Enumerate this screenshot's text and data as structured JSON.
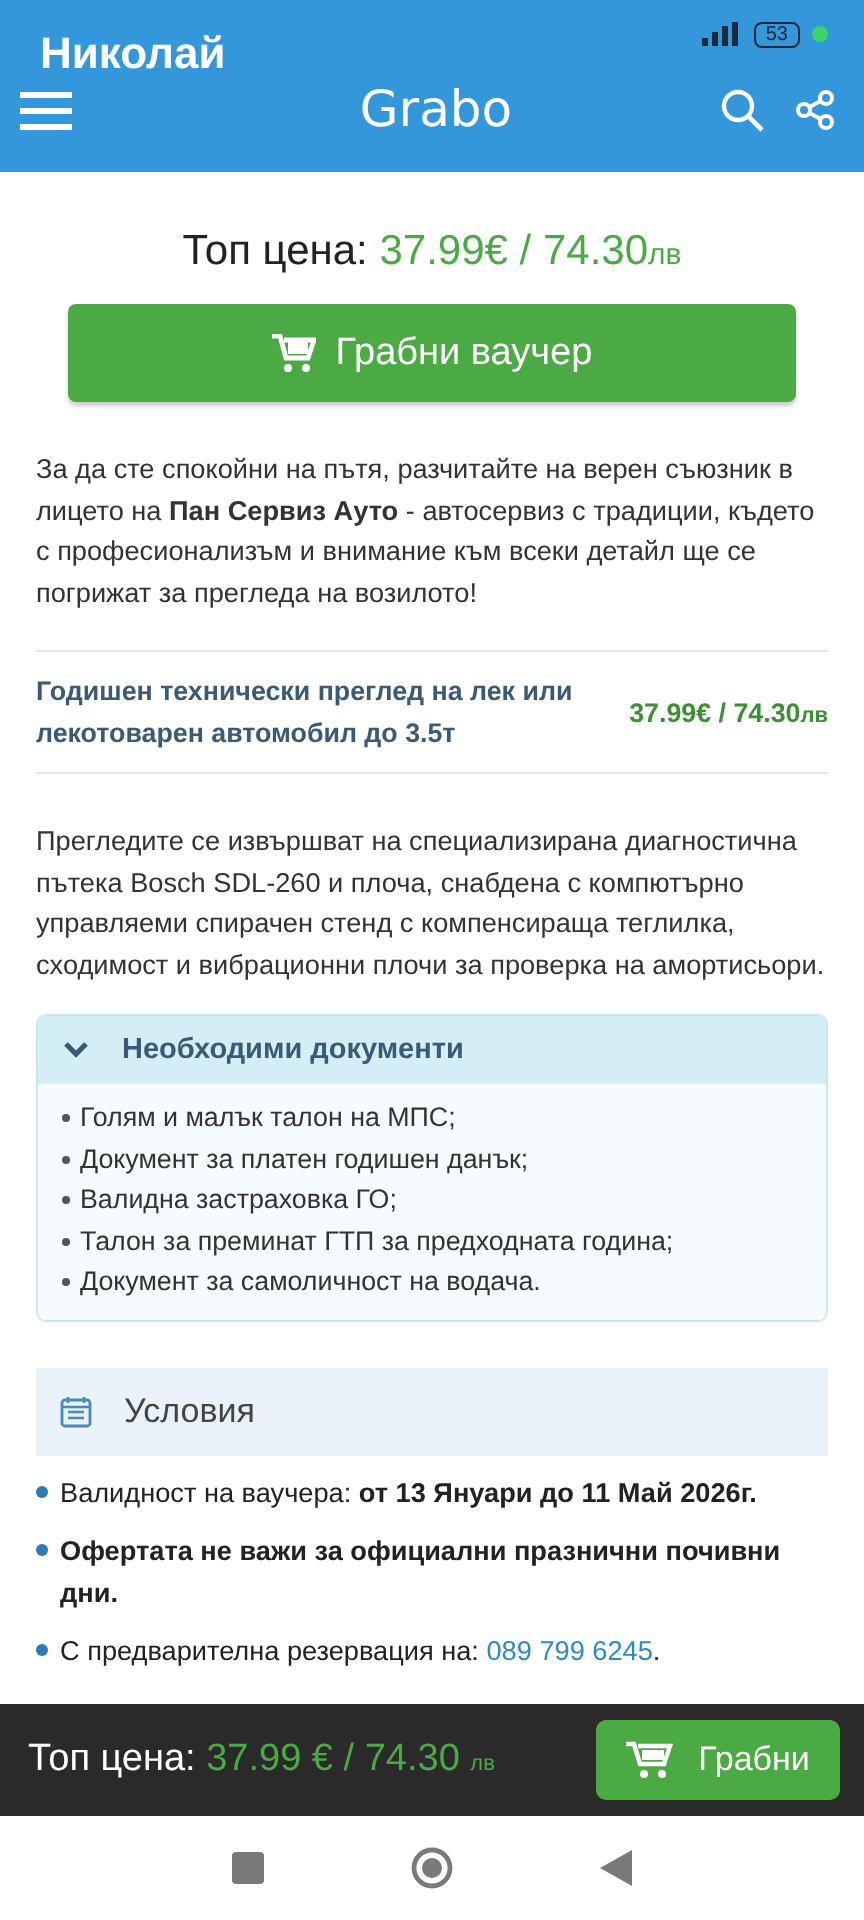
{
  "status_bar": {
    "battery": "53"
  },
  "overlay_caption": "Николай",
  "app_bar": {
    "logo": "Grabo"
  },
  "top_price": {
    "label": "Топ цена:",
    "price": "37.99€ / 74.30",
    "currency": "лв"
  },
  "grab_button": {
    "label": "Грабни ваучер"
  },
  "intro": "За да сте спокойни на пътя, разчитайте на верен съюзник в лицето на **Пан Сервиз Ауто** - автосервиз с традиции, където с професионализъм и внимание към всеки детайл ще се погрижат за прегледа на возилото!",
  "offers": [
    {
      "title": "Годишен технически преглед на лек или лекотоварен автомобил до 3.5т",
      "price": "37.99€ / 74.30",
      "currency": "лв"
    }
  ],
  "description": "Прегледите се извършват на специализирана диагностична пътека Bosch SDL-260 и плоча, снабдена с компютърно управляеми спирачен стенд с компенсираща теглилка, сходимост и вибрационни плочи за проверка на амортисьори.",
  "documents": {
    "title": "Необходими документи",
    "expanded": true,
    "items": [
      "Голям и малък талон на МПС;",
      "Документ за платен годишен данък;",
      "Валидна застраховка ГО;",
      "Талон за преминат ГТП за предходната година;",
      "Документ за самоличност на водача."
    ]
  },
  "conditions": {
    "title": "Условия",
    "items": [
      {
        "text": "Валидност на ваучера: **от 13 Януари до 11 Май 2026г.**"
      },
      {
        "text": "**Офертата не важи за официални празнични почивни дни.**"
      },
      {
        "text": "С предварителна резервация на: ",
        "link": "089 799 6245",
        "after": "."
      }
    ]
  },
  "bottom_bar": {
    "label": "Топ цена:",
    "price": "37.99 € / 74.30",
    "currency": "лв",
    "button": "Грабни"
  }
}
